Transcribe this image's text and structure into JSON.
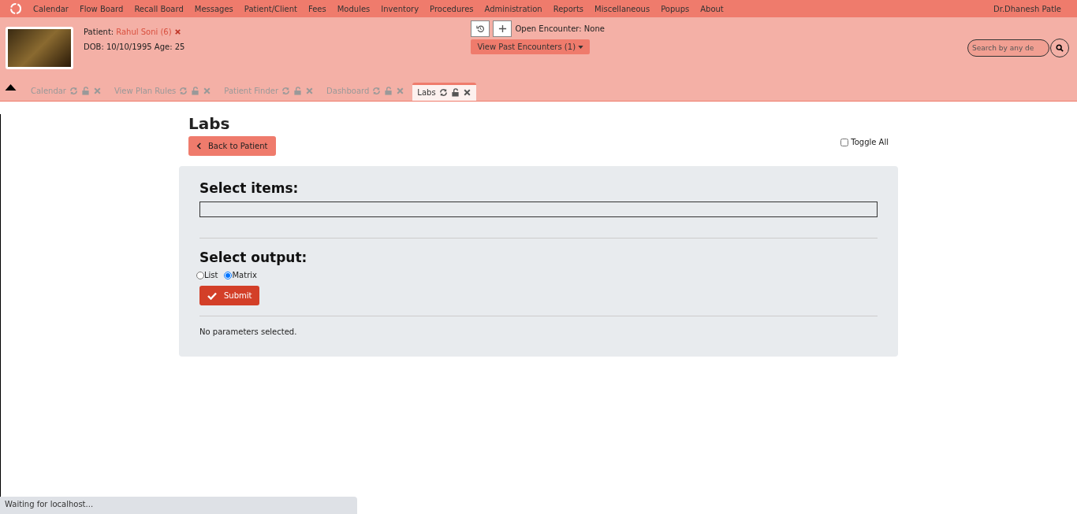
{
  "menu": [
    "Calendar",
    "Flow Board",
    "Recall Board",
    "Messages",
    "Patient/Client",
    "Fees",
    "Modules",
    "Inventory",
    "Procedures",
    "Administration",
    "Reports",
    "Miscellaneous",
    "Popups",
    "About"
  ],
  "user": "Dr.Dhanesh Patle",
  "patient": {
    "label": "Patient:",
    "name": "Rahul Soni (6)",
    "dob": "DOB: 10/10/1995 Age: 25"
  },
  "encounter": {
    "open": "Open Encounter: None",
    "past": "View Past Encounters  (1)"
  },
  "search": {
    "placeholder": "Search by any de"
  },
  "tabs": [
    {
      "label": "Calendar",
      "selected": false
    },
    {
      "label": "View Plan Rules",
      "selected": false
    },
    {
      "label": "Patient Finder",
      "selected": false
    },
    {
      "label": "Dashboard",
      "selected": false
    },
    {
      "label": "Labs",
      "selected": true
    }
  ],
  "page": {
    "title": "Labs",
    "back": "Back to Patient",
    "toggle_all": {
      "label": "Toggle All",
      "checked": false
    },
    "items_heading": "Select items:",
    "output_heading": "Select output:",
    "outputs": [
      {
        "label": "List",
        "selected": false
      },
      {
        "label": "Matrix",
        "selected": true
      }
    ],
    "submit": "Submit",
    "message": "No parameters selected."
  },
  "status_bar": "Waiting for localhost..."
}
